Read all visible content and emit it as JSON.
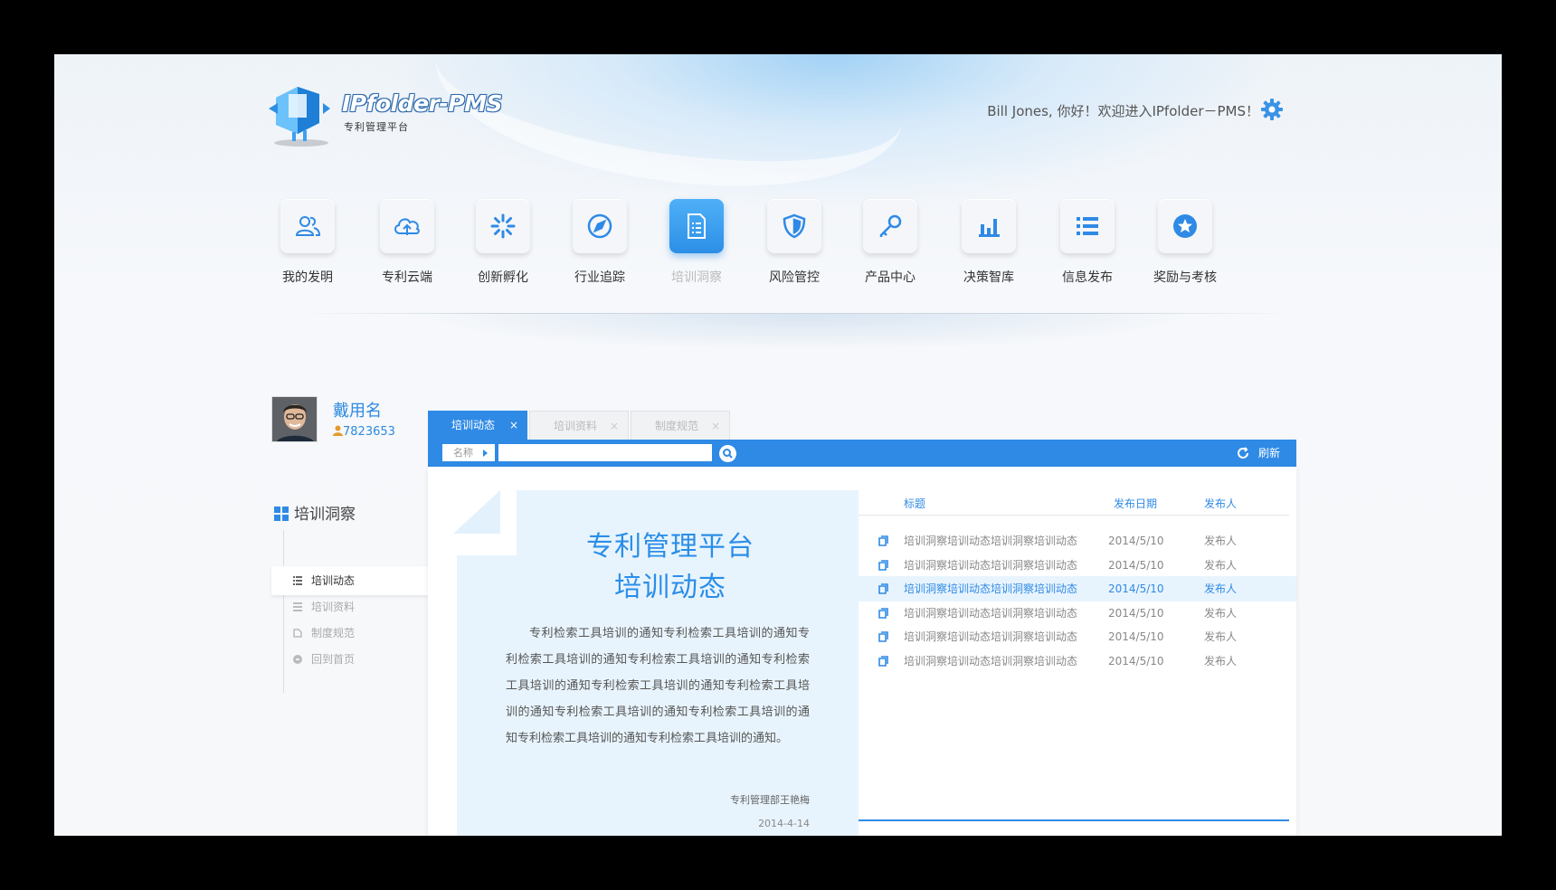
{
  "brand": {
    "title": "IPfolder-PMS",
    "subtitle": "专利管理平台"
  },
  "header": {
    "greeting": "Bill Jones, 你好！欢迎进入IPfolder－PMS！"
  },
  "colors": {
    "accent": "#2f8ae6",
    "accent_light": "#e8f4fd"
  },
  "nav": [
    {
      "label": "我的发明",
      "icon": "users-icon"
    },
    {
      "label": "专利云端",
      "icon": "cloud-upload-icon"
    },
    {
      "label": "创新孵化",
      "icon": "spinner-icon"
    },
    {
      "label": "行业追踪",
      "icon": "compass-icon"
    },
    {
      "label": "培训洞察",
      "icon": "document-icon",
      "active": true
    },
    {
      "label": "风险管控",
      "icon": "shield-icon"
    },
    {
      "label": "产品中心",
      "icon": "key-icon"
    },
    {
      "label": "决策智库",
      "icon": "bar-chart-icon"
    },
    {
      "label": "信息发布",
      "icon": "list-icon"
    },
    {
      "label": "奖励与考核",
      "icon": "star-icon"
    }
  ],
  "user": {
    "name": "戴用名",
    "id": "7823653"
  },
  "sidebar": {
    "title": "培训洞察",
    "items": [
      {
        "label": "培训动态",
        "active": true
      },
      {
        "label": "培训资料"
      },
      {
        "label": "制度规范"
      },
      {
        "label": "回到首页"
      }
    ]
  },
  "tabs": [
    {
      "label": "培训动态",
      "close": "×"
    },
    {
      "label": "培训资料",
      "close": "×"
    },
    {
      "label": "制度规范",
      "close": "×"
    }
  ],
  "toolbar": {
    "name_label": "名称",
    "search_placeholder": "",
    "refresh_label": "刷新"
  },
  "doc": {
    "title_line1": "专利管理平台",
    "title_line2": "培训动态",
    "body": "专利检索工具培训的通知专利检索工具培训的通知专利检索工具培训的通知专利检索工具培训的通知专利检索工具培训的通知专利检索工具培训的通知专利检索工具培训的通知专利检索工具培训的通知专利检索工具培训的通知专利检索工具培训的通知专利检索工具培训的通知。",
    "signature": "专利管理部王艳梅",
    "date": "2014-4-14"
  },
  "list": {
    "headers": {
      "title": "标题",
      "date": "发布日期",
      "publisher": "发布人"
    },
    "rows": [
      {
        "title": "培训洞察培训动态培训洞察培训动态",
        "date": "2014/5/10",
        "publisher": "发布人"
      },
      {
        "title": "培训洞察培训动态培训洞察培训动态",
        "date": "2014/5/10",
        "publisher": "发布人"
      },
      {
        "title": "培训洞察培训动态培训洞察培训动态",
        "date": "2014/5/10",
        "publisher": "发布人",
        "active": true
      },
      {
        "title": "培训洞察培训动态培训洞察培训动态",
        "date": "2014/5/10",
        "publisher": "发布人"
      },
      {
        "title": "培训洞察培训动态培训洞察培训动态",
        "date": "2014/5/10",
        "publisher": "发布人"
      },
      {
        "title": "培训洞察培训动态培训洞察培训动态",
        "date": "2014/5/10",
        "publisher": "发布人"
      }
    ]
  }
}
